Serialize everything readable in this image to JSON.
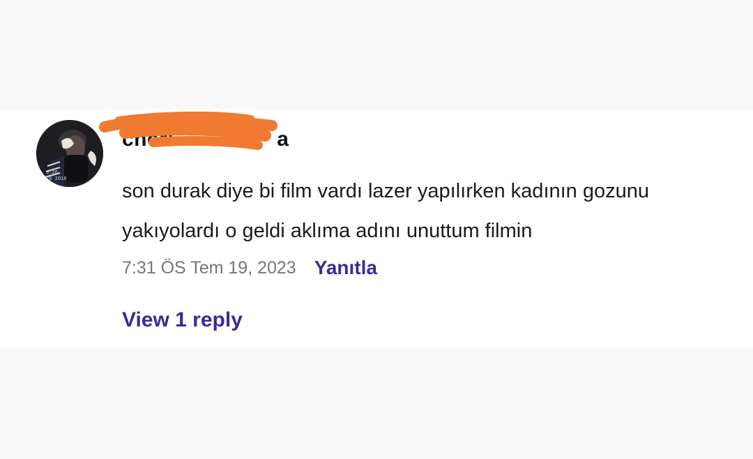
{
  "comment": {
    "avatar": {
      "icon": "user-avatar-photo",
      "overlay_text_1": "9:26",
      "overlay_text_2": "28 2018"
    },
    "author": {
      "username": "cheri",
      "username_suffix": "a",
      "redaction_color": "#f07a30"
    },
    "text": "son durak diye bi film vardı lazer yapılırken kadının gozunu yakıyolardı o geldi aklıma adını unuttum filmin",
    "timestamp": "7:31 ÖS Tem 19, 2023",
    "reply_label": "Yanıtla",
    "view_replies_label": "View 1 reply",
    "accent_color": "#3d2a96"
  }
}
